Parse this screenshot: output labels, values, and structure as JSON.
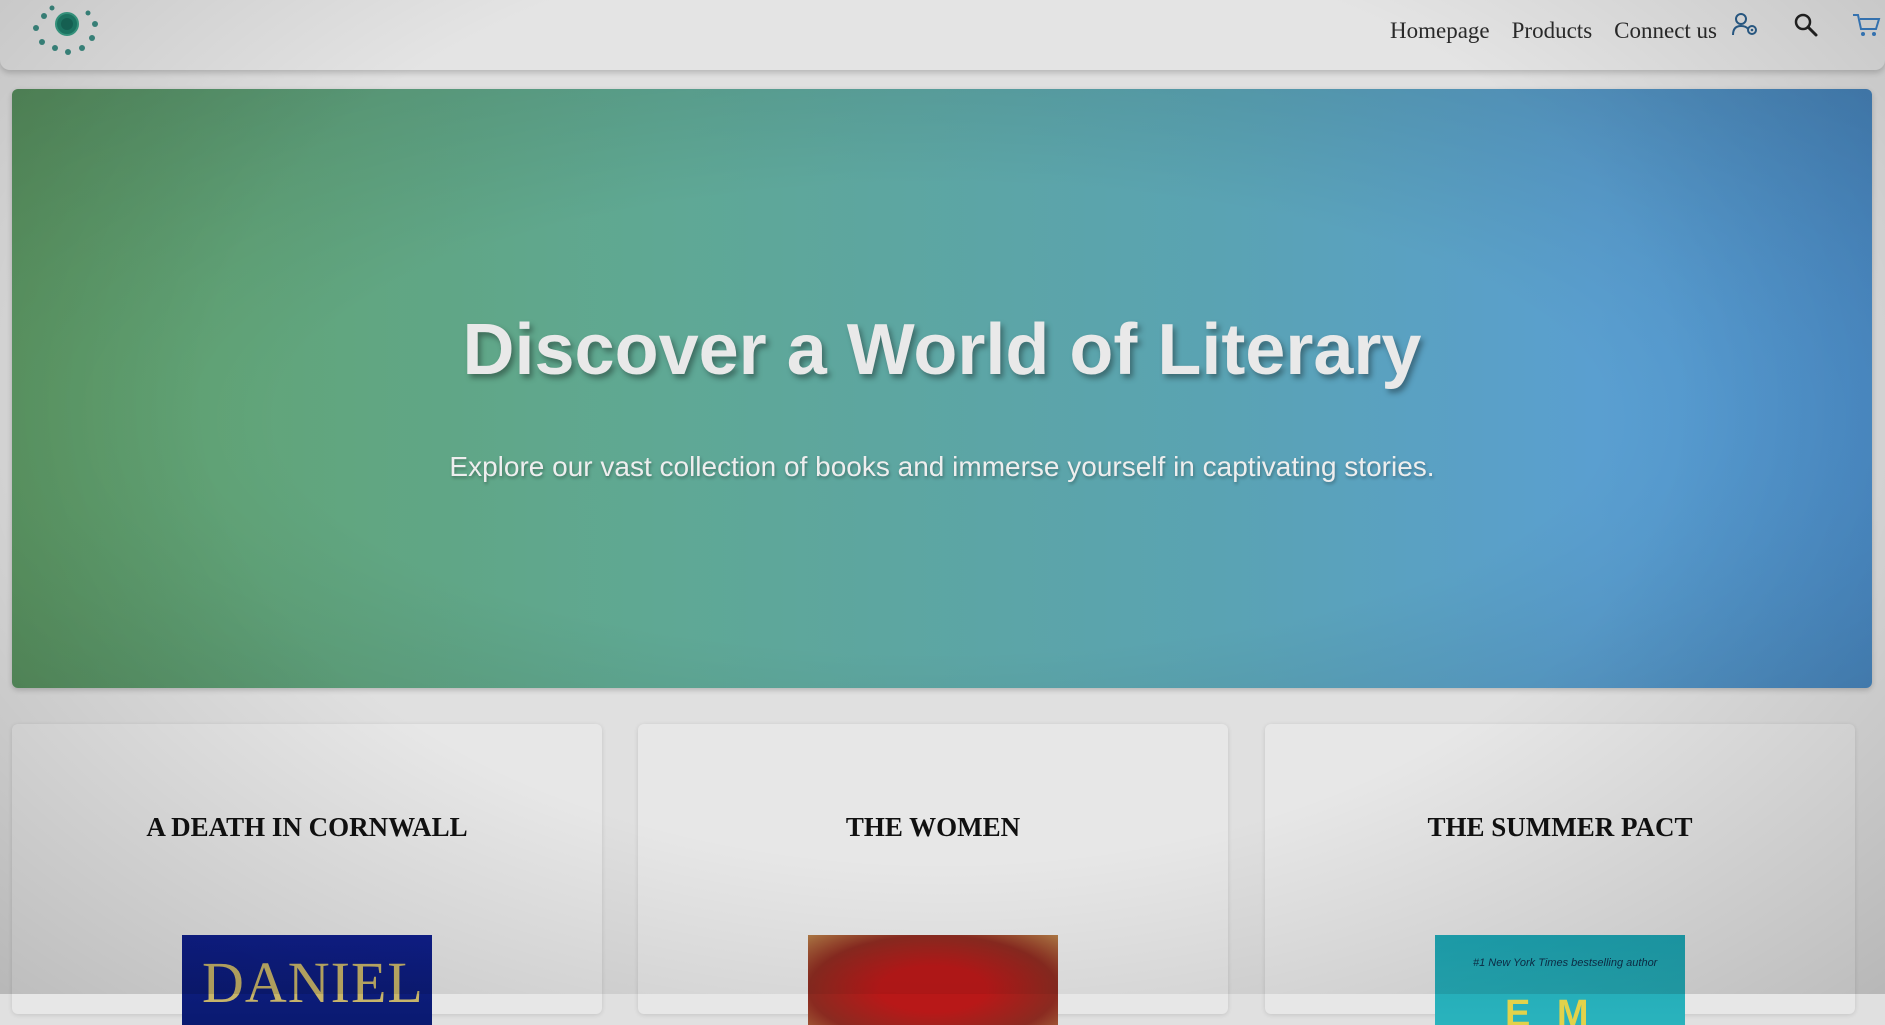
{
  "nav": {
    "links": [
      "Homepage",
      "Products",
      "Connect us"
    ],
    "icons": [
      "user-settings-icon",
      "search-icon",
      "cart-icon"
    ]
  },
  "hero": {
    "title": "Discover a World of Literary",
    "subtitle": "Explore our vast collection of books and immerse yourself in captivating stories."
  },
  "products": [
    {
      "title": "A DEATH IN CORNWALL",
      "cover_text": "DANIEL"
    },
    {
      "title": "THE WOMEN",
      "cover_text": ""
    },
    {
      "title": "THE SUMMER PACT",
      "cover_text": "#1 New York Times bestselling author"
    }
  ],
  "colors": {
    "hero_start": "#63a36b",
    "hero_end": "#5197d6",
    "icon_accent": "#2a5d8a"
  }
}
